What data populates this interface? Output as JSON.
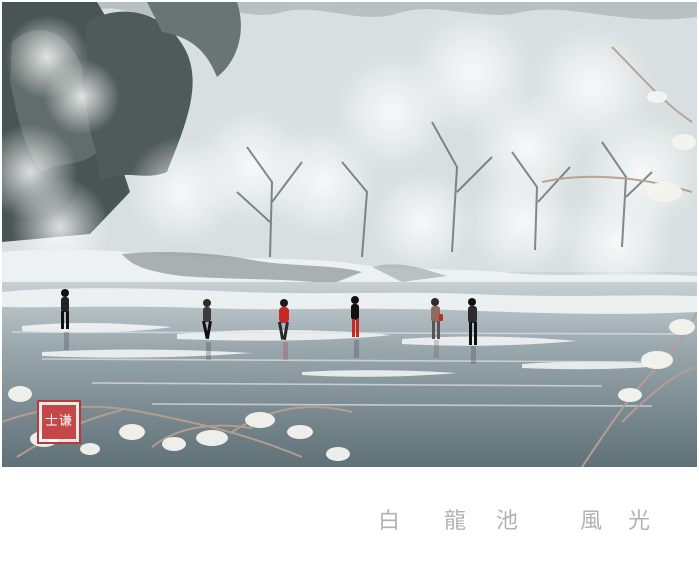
{
  "seal": {
    "text": "士谦"
  },
  "caption": {
    "chars": [
      "白",
      "龍",
      "池",
      "風",
      "光"
    ]
  },
  "colors": {
    "seal_red": "#c44848",
    "caption_gray": "#b2b2b2",
    "ice": "#7c8c93",
    "snow": "#eef1f2",
    "forest": "#3f4b4d"
  },
  "scene": {
    "people": [
      {
        "coat": "#222222"
      },
      {
        "coat": "#3b3b3b"
      },
      {
        "coat": "#c62828"
      },
      {
        "coat": "#111111"
      },
      {
        "coat": "#8d6d5a"
      },
      {
        "coat": "#2c2c2c"
      }
    ]
  }
}
